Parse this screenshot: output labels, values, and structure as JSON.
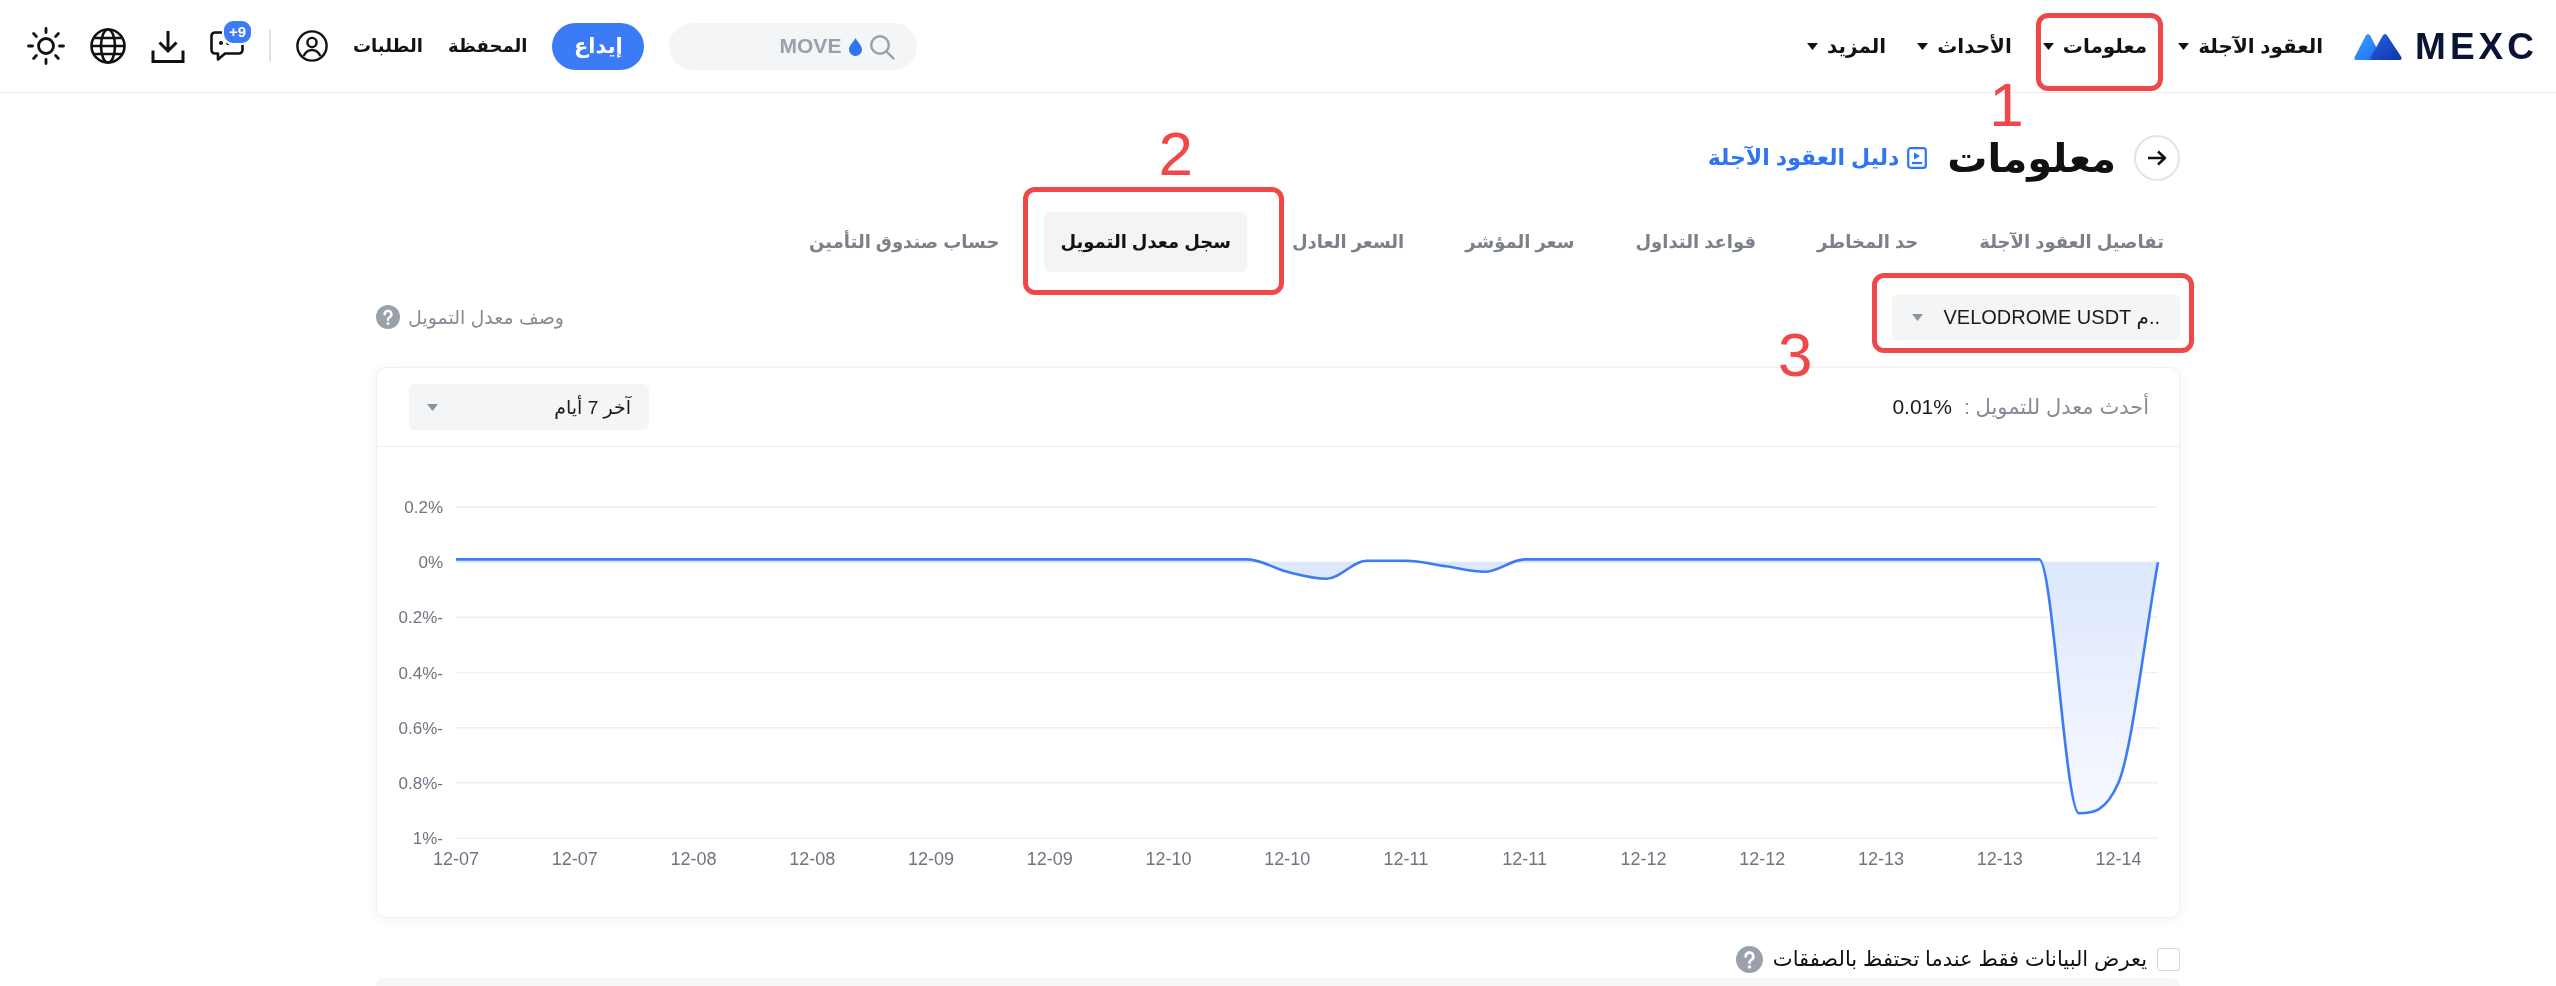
{
  "top_bar": {
    "logo": "MEXC",
    "nav": [
      {
        "label": "العقود الآجلة"
      },
      {
        "label": "معلومات",
        "callout": "1"
      },
      {
        "label": "الأحداث"
      },
      {
        "label": "المزيد"
      }
    ],
    "search": {
      "placeholder": "MOVE"
    },
    "deposit_button": "إيداع",
    "links": [
      "المحفظة",
      "الطلبات"
    ],
    "notification_badge": "+9"
  },
  "page": {
    "title": "معلومات",
    "guide_link": "دليل العقود الآجلة",
    "tabs": [
      {
        "label": "تفاصيل العقود الآجلة",
        "selected": false
      },
      {
        "label": "حد المخاطر",
        "selected": false
      },
      {
        "label": "قواعد التداول",
        "selected": false
      },
      {
        "label": "سعر المؤشر",
        "selected": false
      },
      {
        "label": "السعر العادل",
        "selected": false
      },
      {
        "label": "سجل معدل التمويل",
        "selected": true,
        "callout": "2"
      },
      {
        "label": "حساب صندوق التأمين",
        "selected": false
      }
    ],
    "symbol_select": {
      "value": "VELODROME USDT م..",
      "callout": "3"
    },
    "help_link": "وصف معدل التمويل",
    "chart_card": {
      "latest_label": "أحدث معدل للتمويل :",
      "latest_value": "0.01%",
      "period_select": {
        "value": "آخر 7 أيام"
      },
      "chart_data": {
        "type": "area",
        "grid": true,
        "categories": [
          "12-07",
          null,
          null,
          "12-07",
          null,
          null,
          "12-08",
          null,
          null,
          "12-08",
          null,
          null,
          "12-09",
          null,
          null,
          "12-09",
          null,
          null,
          "12-10",
          null,
          null,
          "12-10",
          null,
          null,
          "12-11",
          null,
          null,
          "12-11",
          null,
          null,
          "12-12",
          null,
          null,
          "12-12",
          null,
          null,
          "12-13",
          null,
          null,
          "12-13",
          null,
          null,
          "12-14",
          null
        ],
        "values": [
          0.01,
          0.01,
          0.01,
          0.01,
          0.01,
          0.01,
          0.01,
          0.01,
          0.01,
          0.01,
          0.01,
          0.01,
          0.01,
          0.01,
          0.01,
          0.01,
          0.01,
          0.01,
          0.01,
          0.01,
          0.01,
          -0.035,
          -0.06,
          0.005,
          0.005,
          -0.015,
          -0.035,
          0.01,
          0.01,
          0.01,
          0.01,
          0.01,
          0.01,
          0.01,
          0.01,
          0.01,
          0.01,
          0.01,
          0.01,
          0.01,
          0.01,
          -0.91,
          -0.8,
          0.0
        ],
        "ylim": [
          -1,
          0.2
        ],
        "yticks": [
          {
            "value": 0.2,
            "label": "0.2%"
          },
          {
            "value": 0,
            "label": "0%"
          },
          {
            "value": -0.2,
            "label": "0.2%-"
          },
          {
            "value": -0.4,
            "label": "0.4%-"
          },
          {
            "value": -0.6,
            "label": "0.6%-"
          },
          {
            "value": -0.8,
            "label": "0.8%-"
          },
          {
            "value": -1,
            "label": "1%-"
          }
        ]
      }
    },
    "holdings_filter": {
      "label": "يعرض البيانات فقط عندما تحتفظ بالصفقات",
      "checked": false
    }
  }
}
